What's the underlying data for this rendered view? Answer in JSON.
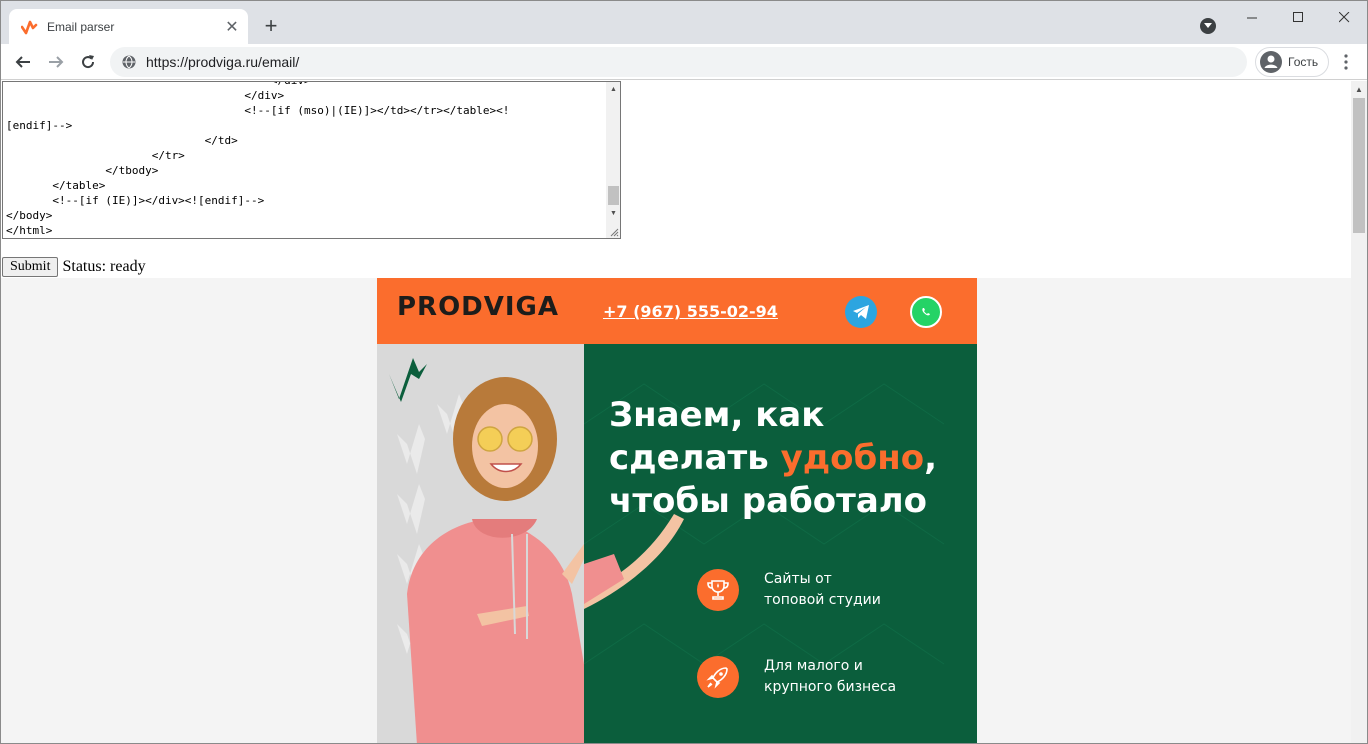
{
  "browser": {
    "tab_title": "Email parser",
    "new_tab": "+",
    "url": "https://prodviga.ru/email/",
    "profile_label": "Гость"
  },
  "editor": {
    "lines": [
      "                                        </div>",
      "                                    </div>",
      "                                    <!--[if (mso)|(IE)]></td></tr></table><!",
      "[endif]-->",
      "                              </td>",
      "                      </tr>",
      "               </tbody>",
      "       </table>",
      "       <!--[if (IE)]></div><![endif]-->",
      "</body>",
      "</html>"
    ]
  },
  "form": {
    "submit_label": "Submit",
    "status_text": "Status: ready"
  },
  "email": {
    "logo_text": "PRODVIGA",
    "phone": "+7 (967) 555-02-94",
    "headline_line1": "Знаем, как",
    "headline_line2_a": "сделать ",
    "headline_line2_accent": "удобно",
    "headline_line2_b": ",",
    "headline_line3": "чтобы работало",
    "features": [
      {
        "icon": "trophy-icon",
        "line1": "Сайты от",
        "line2": "топовой студии"
      },
      {
        "icon": "rocket-icon",
        "line1": "Для малого и",
        "line2": "крупного бизнеса"
      }
    ],
    "colors": {
      "orange": "#fb6d2d",
      "green": "#0b5e3c",
      "dark": "#1d1d1b"
    }
  }
}
